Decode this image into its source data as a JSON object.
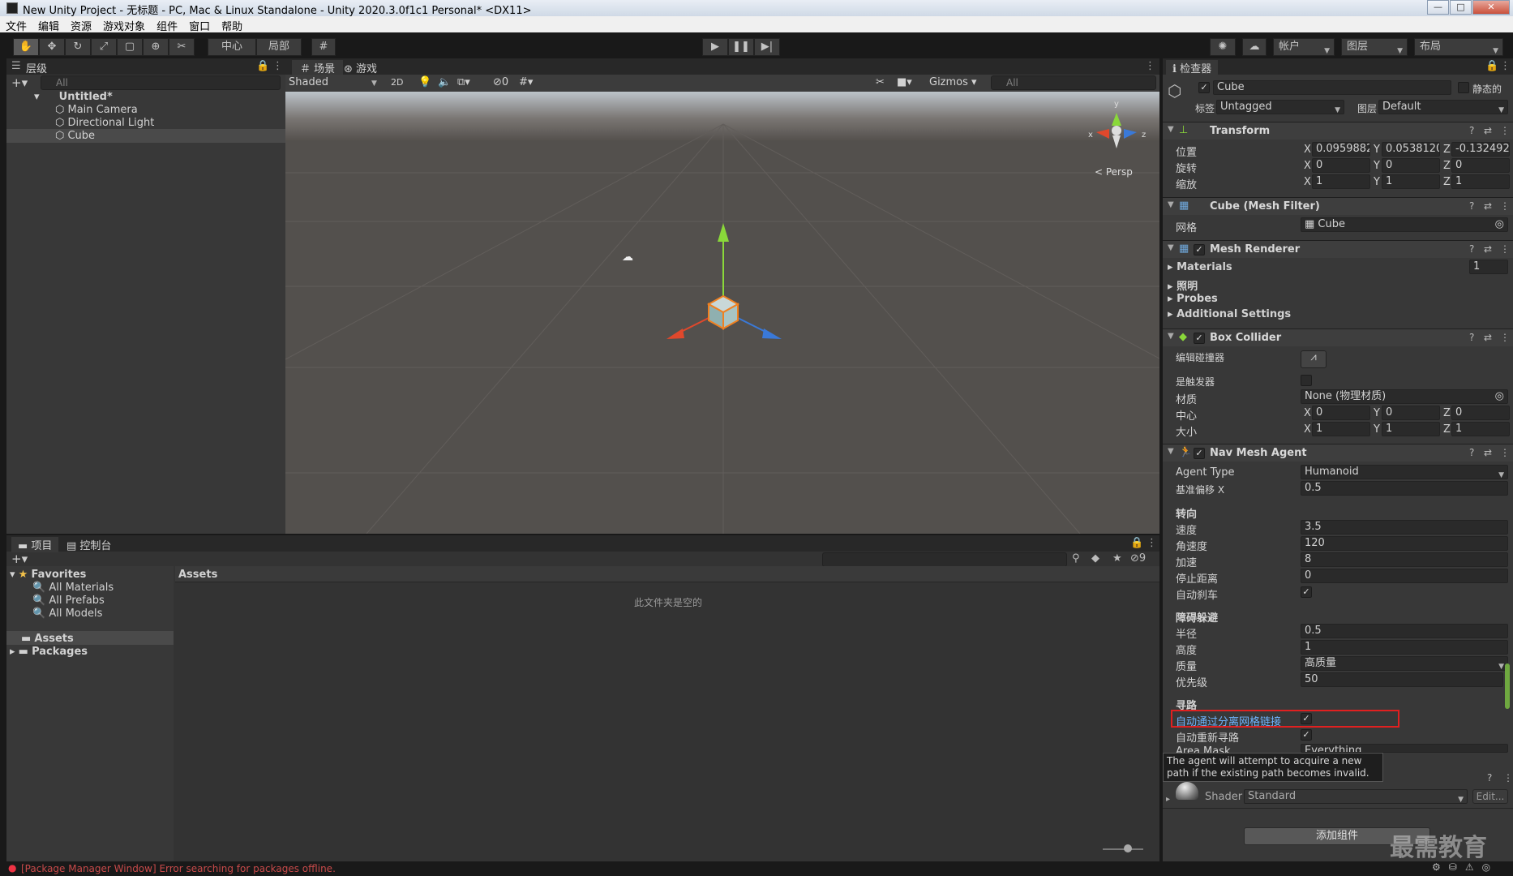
{
  "window": {
    "title": "New Unity Project - 无标题 - PC, Mac & Linux Standalone - Unity 2020.3.0f1c1 Personal* <DX11>"
  },
  "menu": [
    "文件",
    "编辑",
    "资源",
    "游戏对象",
    "组件",
    "窗口",
    "帮助"
  ],
  "toolbar": {
    "pivot": "中心",
    "local": "局部",
    "account": "帐户",
    "layers": "图层",
    "layout": "布局"
  },
  "hierarchy": {
    "tab": "层级",
    "search_placeholder": "All",
    "scene": "Untitled*",
    "items": [
      "Main Camera",
      "Directional Light",
      "Cube"
    ]
  },
  "scene": {
    "tab_scene": "场景",
    "tab_game": "游戏",
    "shading": "Shaded",
    "mode2d": "2D",
    "hidden_count": "0",
    "gizmos": "Gizmos",
    "search_placeholder": "All",
    "persp": "< Persp",
    "axis_y": "y",
    "axis_x": "x",
    "axis_z": "z"
  },
  "project": {
    "tab_project": "项目",
    "tab_console": "控制台",
    "favorites": "Favorites",
    "fav_items": [
      "All Materials",
      "All Prefabs",
      "All Models"
    ],
    "folders": [
      "Assets",
      "Packages"
    ],
    "breadcrumb": "Assets",
    "empty_text": "此文件夹是空的",
    "hidden_count": "9"
  },
  "status": {
    "error": "[Package Manager Window] Error searching for packages offline."
  },
  "inspector": {
    "tab": "检查器",
    "object_name": "Cube",
    "static_label": "静态的",
    "tag_label": "标签",
    "tag_value": "Untagged",
    "layer_label": "图层",
    "layer_value": "Default",
    "transform": {
      "title": "Transform",
      "position_label": "位置",
      "rotation_label": "旋转",
      "scale_label": "缩放",
      "position": {
        "x": "0.09598827",
        "y": "0.05381203",
        "z": "-0.1324921"
      },
      "rotation": {
        "x": "0",
        "y": "0",
        "z": "0"
      },
      "scale": {
        "x": "1",
        "y": "1",
        "z": "1"
      }
    },
    "mesh_filter": {
      "title": "Cube (Mesh Filter)",
      "mesh_label": "网格",
      "mesh_value": "Cube"
    },
    "mesh_renderer": {
      "title": "Mesh Renderer",
      "materials": "Materials",
      "materials_count": "1",
      "lighting": "照明",
      "probes": "Probes",
      "additional": "Additional Settings"
    },
    "box_collider": {
      "title": "Box Collider",
      "edit_label": "编辑碰撞器",
      "trigger_label": "是触发器",
      "material_label": "材质",
      "material_value": "None (物理材质)",
      "center_label": "中心",
      "size_label": "大小",
      "center": {
        "x": "0",
        "y": "0",
        "z": "0"
      },
      "size": {
        "x": "1",
        "y": "1",
        "z": "1"
      }
    },
    "nav_agent": {
      "title": "Nav Mesh Agent",
      "agent_type_label": "Agent Type",
      "agent_type_value": "Humanoid",
      "base_offset_label": "基准偏移 X",
      "base_offset_value": "0.5",
      "steering": "转向",
      "speed_label": "速度",
      "speed": "3.5",
      "angular_label": "角速度",
      "angular": "120",
      "accel_label": "加速",
      "accel": "8",
      "stop_label": "停止距离",
      "stop": "0",
      "brake_label": "自动刹车",
      "avoidance": "障碍躲避",
      "radius_label": "半径",
      "radius": "0.5",
      "height_label": "高度",
      "height": "1",
      "quality_label": "质量",
      "quality": "高质量",
      "priority_label": "优先级",
      "priority": "50",
      "pathfinding": "寻路",
      "auto_traverse_label": "自动通过分离网格链接",
      "auto_repath_label": "自动重新寻路",
      "area_mask_label": "Area Mask",
      "area_mask_value": "Everything"
    },
    "tooltip": "The agent will attempt to acquire a new path if the existing path becomes invalid.",
    "material": {
      "shader_label": "Shader",
      "shader_value": "Standard",
      "edit": "Edit..."
    },
    "add_component": "添加组件",
    "watermark": "最需教育"
  },
  "colors": {
    "highlight_red": "#e02020",
    "accent_blue": "#3a79d8"
  }
}
